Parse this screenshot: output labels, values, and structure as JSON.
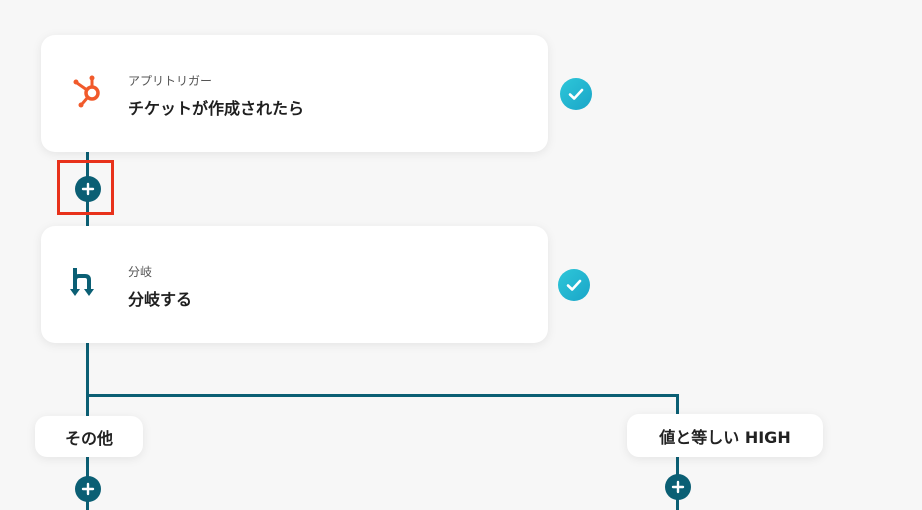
{
  "flow": {
    "trigger": {
      "subtitle": "アプリトリガー",
      "title": "チケットが作成されたら",
      "icon": "hubspot-icon",
      "status_icon": "check-icon"
    },
    "branch": {
      "subtitle": "分岐",
      "title": "分岐する",
      "icon": "branch-icon",
      "status_icon": "check-icon"
    },
    "branches": {
      "left_label": "その他",
      "right_label": "値と等しい HIGH"
    }
  },
  "colors": {
    "accent": "#0b5f74",
    "check": "#22b8d3",
    "highlight": "#e8321b",
    "hubspot": "#f15a2b"
  }
}
